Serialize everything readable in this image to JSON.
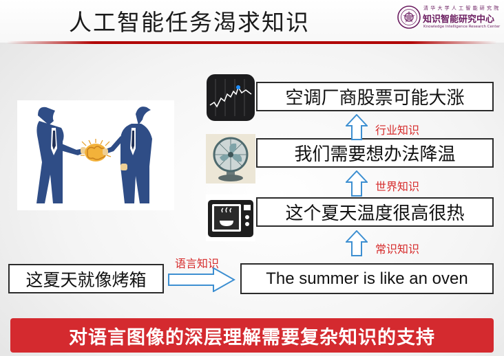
{
  "header": {
    "title": "人工智能任务渴求知识",
    "logo_small": "清 华 大 学 人 工 智 能 研 究 院",
    "logo_name": "知识智能研究中心",
    "logo_english": "Knowledge Intelligence Research Center"
  },
  "chain": {
    "stock_statement": "空调厂商股票可能大涨",
    "cooling_statement": "我们需要想办法降温",
    "hot_statement": "这个夏天温度很高很热",
    "english_statement": "The summer is like an oven",
    "source_statement": "这夏天就像烤箱"
  },
  "knowledge": {
    "industry": "行业知识",
    "world": "世界知识",
    "common": "常识知识",
    "language": "语言知识"
  },
  "banner": {
    "text": "对语言图像的深层理解需要复杂知识的支持"
  },
  "icons": [
    "stock-chart-icon",
    "electric-fan-icon",
    "microwave-icon"
  ],
  "colors": {
    "accent_red": "#d42a2f",
    "arrow_blue": "#3d8fd1",
    "label_red": "#d62b2b",
    "suit_blue": "#2f4d86"
  }
}
